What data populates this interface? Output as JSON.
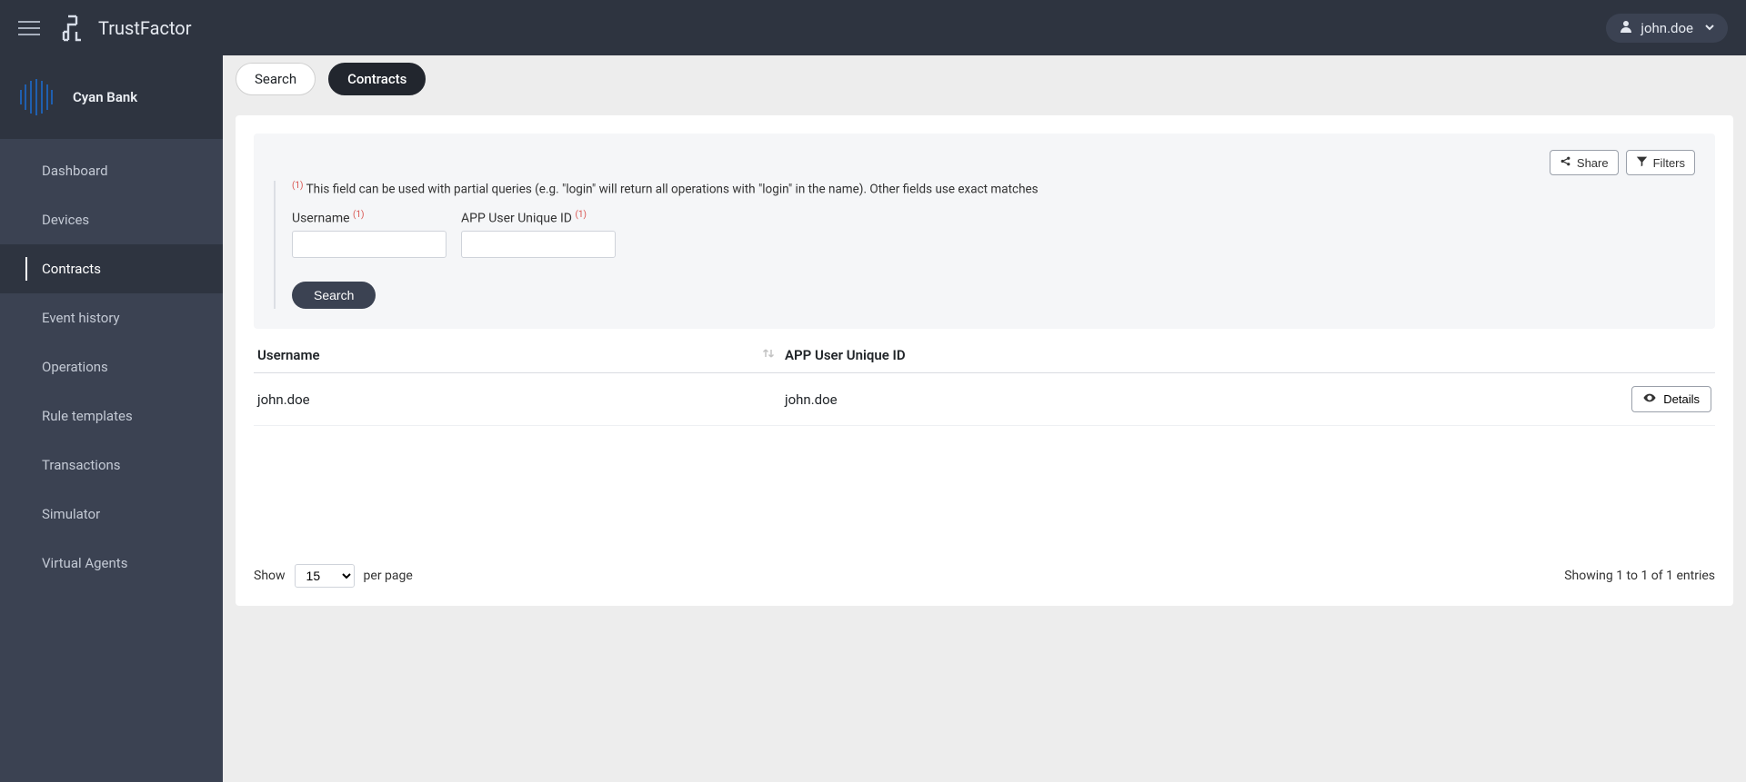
{
  "brand": "TrustFactor",
  "user": {
    "name": "john.doe"
  },
  "tenant": {
    "name": "Cyan Bank"
  },
  "sidebar": {
    "items": [
      {
        "label": "Dashboard"
      },
      {
        "label": "Devices"
      },
      {
        "label": "Contracts"
      },
      {
        "label": "Event history"
      },
      {
        "label": "Operations"
      },
      {
        "label": "Rule templates"
      },
      {
        "label": "Transactions"
      },
      {
        "label": "Simulator"
      },
      {
        "label": "Virtual Agents"
      }
    ],
    "active_index": 2
  },
  "tabs": {
    "items": [
      {
        "label": "Search"
      },
      {
        "label": "Contracts"
      }
    ],
    "active_index": 1
  },
  "panel": {
    "share_label": "Share",
    "filters_label": "Filters",
    "sup_mark": "(1)",
    "hint_text": "This field can be used with partial queries (e.g. \"login\" will return all operations with \"login\" in the name). Other fields use exact matches",
    "fields": {
      "username_label": "Username",
      "appid_label": "APP User Unique ID"
    },
    "search_btn": "Search"
  },
  "table": {
    "headers": {
      "username": "Username",
      "appid": "APP User Unique ID"
    },
    "rows": [
      {
        "username": "john.doe",
        "appid": "john.doe"
      }
    ],
    "details_label": "Details"
  },
  "pager": {
    "show_label": "Show",
    "per_page_label": "per page",
    "page_size": "15",
    "summary": "Showing 1 to 1 of 1 entries"
  }
}
